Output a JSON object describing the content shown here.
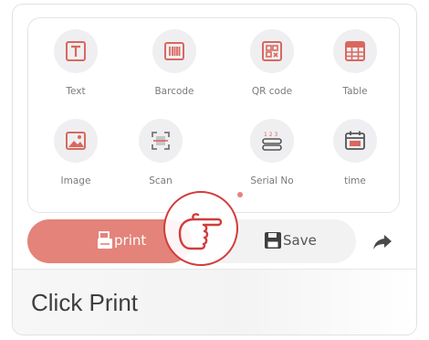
{
  "tools": [
    {
      "label": "Text",
      "icon": "text-icon"
    },
    {
      "label": "Barcode",
      "icon": "barcode-icon"
    },
    {
      "label": "QR code",
      "icon": "qr-code-icon"
    },
    {
      "label": "Table",
      "icon": "table-icon"
    },
    {
      "label": "Image",
      "icon": "image-icon"
    },
    {
      "label": "Scan",
      "icon": "scan-icon"
    },
    {
      "label": "Serial No",
      "icon": "serial-number-icon"
    },
    {
      "label": "time",
      "icon": "calendar-icon"
    }
  ],
  "actions": {
    "print_label": "print",
    "save_label": "Save"
  },
  "footer": {
    "caption": "Click Print"
  },
  "colors": {
    "accent": "#e3837a",
    "icon_red": "#d9685f",
    "highlight_ring": "#d23c3c"
  }
}
